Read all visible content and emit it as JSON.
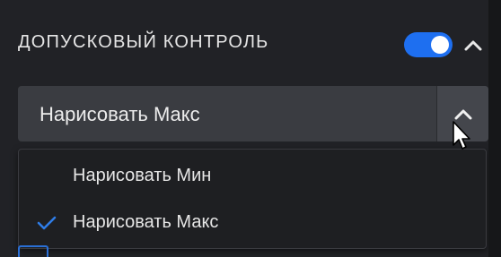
{
  "section": {
    "title": "ДОПУСКОВЫЙ КОНТРОЛЬ",
    "toggle_on": true,
    "toggle_icon": "toggle-switch-icon",
    "collapse_icon": "chevron-up-icon"
  },
  "select": {
    "value": "Нарисовать Макс",
    "arrow_icon": "chevron-up-icon"
  },
  "dropdown": {
    "options": [
      {
        "label": "Нарисовать Мин",
        "selected": false
      },
      {
        "label": "Нарисовать Макс",
        "selected": true
      }
    ],
    "check_icon": "checkmark-icon"
  },
  "colors": {
    "accent": "#1e6ff0",
    "panel_bg": "#212226",
    "select_bg": "#3a3c41",
    "dropdown_bg": "#1e1f22",
    "text": "#e6e6e6"
  }
}
